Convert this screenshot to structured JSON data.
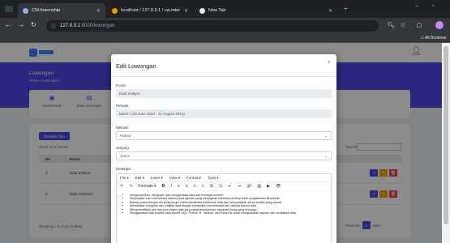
{
  "browser": {
    "tabs": [
      {
        "title": "CW-Internship",
        "active": true,
        "favicon_color": "#8ab4f8"
      },
      {
        "title": "localhost / 127.0.0.1 / cw-inter…",
        "active": false,
        "favicon_color": "#f29900"
      },
      {
        "title": "New Tab",
        "active": false,
        "favicon_color": "#e8eaed"
      }
    ],
    "url_host": "127.0.0.1",
    "url_path": ":8000/lowongan",
    "bookmarks_label": "All Bookmar"
  },
  "page": {
    "title": "Lowongan",
    "breadcrumb": "Home  /  Lowongan",
    "stats": [
      "Dashboard",
      "Data lowongan"
    ],
    "add_button": "Tambah data",
    "show_entries": "Show  10  ▾  entries",
    "search_label": "Search:",
    "table": {
      "headers": [
        "No",
        "Posisi",
        ""
      ],
      "rows": [
        {
          "no": "1",
          "posisi": "Data analyst"
        },
        {
          "no": "2",
          "posisi": "Data Scientist"
        }
      ]
    },
    "showing": "Showing 1 to 2 of 2 entries",
    "pager": {
      "prev": "Previous",
      "current": "1",
      "next": "Next"
    }
  },
  "modal": {
    "title": "Edit Lowongan",
    "close": "×",
    "fields": {
      "posisi": {
        "label": "Posisi",
        "value": "Data analyst"
      },
      "periode": {
        "label": "Periode",
        "value": "Batch I (25 June 2024 - 31 August 2024)"
      },
      "metode": {
        "label": "Metode",
        "value": "Hybrid"
      },
      "jenjang": {
        "label": "Jenjang",
        "value": "Junior"
      },
      "deskripsi": {
        "label": "Deskripsi"
      }
    },
    "editor": {
      "menu": [
        "File ▾",
        "Edit ▾",
        "Insert ▾",
        "View ▾",
        "Format ▾",
        "Tools ▾"
      ],
      "format_label": "Formats ▾",
      "content": [
        "Mengumpulkan, mengolah, dan menganalisis data dari berbagai sumber.",
        "Menyiapkan dan memelihara dasbor serta laporan yang menyajikan informasi penting untuk pengambilan keputusan.",
        "Bekerja sama dengan tim lintas fungsi untuk memahami kebutuhan data dan menyediakan solusi analitik yang sesuai.",
        "Memastikan integritas dan kualitas data dengan melakukan pemeriksaan dan validasi secara rutin.",
        "Mengidentifikasi tren dan pola dalam data yang dapat memberikan wawasan bisnis yang berharga.",
        "Menggunakan alat analisis data seperti SQL, Python, R, Tableau, dan Power BI untuk menghasilkan laporan dan visualisasi data."
      ]
    }
  }
}
